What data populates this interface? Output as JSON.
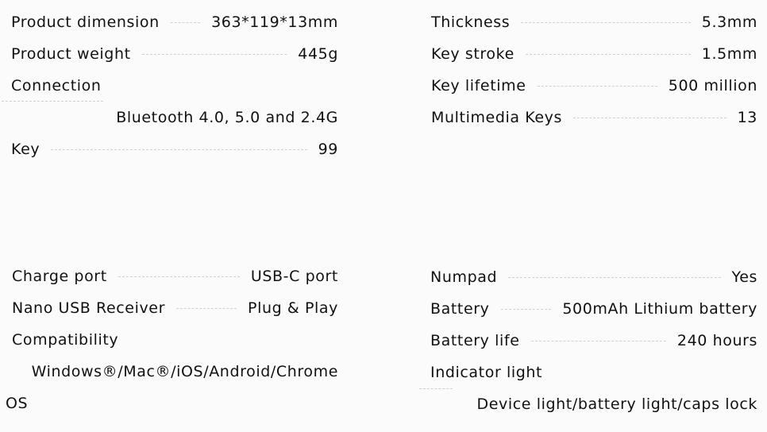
{
  "top_left": [
    {
      "label": "Product dimension",
      "value": "363*119*13mm"
    },
    {
      "label": "Product weight",
      "value": "445g"
    },
    {
      "label": "Connection",
      "value": "Bluetooth 4.0, 5.0 and 2.4G"
    },
    {
      "label": "Key",
      "value": "99"
    }
  ],
  "top_right": [
    {
      "label": "Thickness",
      "value": "5.3mm"
    },
    {
      "label": "Key stroke",
      "value": "1.5mm"
    },
    {
      "label": "Key lifetime",
      "value": "500 million"
    },
    {
      "label": "Multimedia Keys",
      "value": "13"
    }
  ],
  "bottom_left": [
    {
      "label": "Charge port",
      "value": "USB-C port"
    },
    {
      "label": "Nano USB Receiver",
      "value": "Plug & Play"
    },
    {
      "label": "Compatibility",
      "value_line1": "Windows®/Mac®/iOS/Android/Chrome",
      "value_line2": "OS"
    }
  ],
  "bottom_right": [
    {
      "label": "Numpad",
      "value": "Yes"
    },
    {
      "label": "Battery",
      "value": "500mAh Lithium battery"
    },
    {
      "label": "Battery life",
      "value": "240 hours"
    },
    {
      "label": "Indicator light",
      "value": "Device light/battery light/caps lock"
    }
  ]
}
